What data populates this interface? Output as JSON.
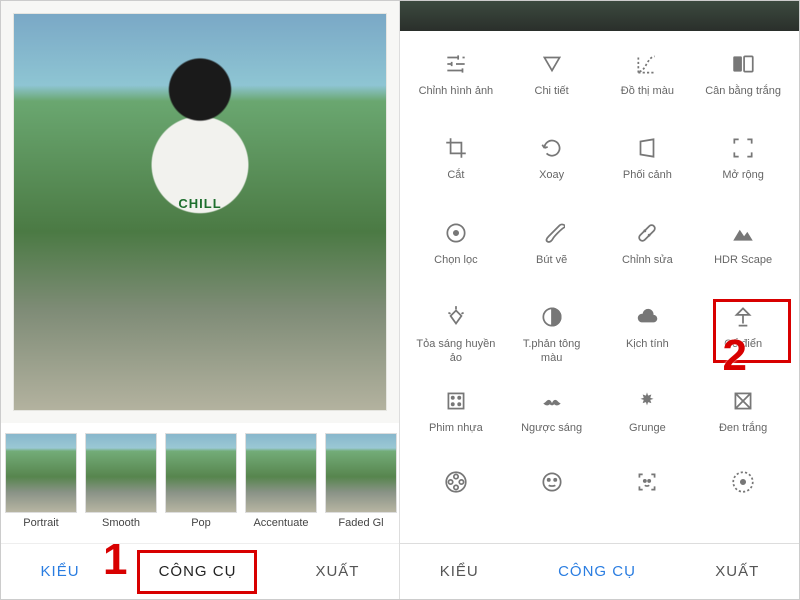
{
  "left": {
    "filters": [
      {
        "label": "Portrait"
      },
      {
        "label": "Smooth"
      },
      {
        "label": "Pop"
      },
      {
        "label": "Accentuate"
      },
      {
        "label": "Faded Gl"
      }
    ],
    "bottombar": {
      "kieu": "KIỂU",
      "congcu": "CÔNG CỤ",
      "xuat": "XUẤT"
    },
    "annot1": "1"
  },
  "right": {
    "tools": [
      [
        {
          "icon": "tune",
          "label": "Chỉnh hình ảnh"
        },
        {
          "icon": "triangle-down",
          "label": "Chi tiết"
        },
        {
          "icon": "curve",
          "label": "Đồ thị màu"
        },
        {
          "icon": "wb",
          "label": "Cân bằng trắng"
        }
      ],
      [
        {
          "icon": "crop",
          "label": "Cắt"
        },
        {
          "icon": "rotate",
          "label": "Xoay"
        },
        {
          "icon": "perspective",
          "label": "Phối cảnh"
        },
        {
          "icon": "expand",
          "label": "Mở rộng"
        }
      ],
      [
        {
          "icon": "target",
          "label": "Chọn lọc"
        },
        {
          "icon": "brush",
          "label": "Bút vẽ"
        },
        {
          "icon": "bandage",
          "label": "Chỉnh sửa"
        },
        {
          "icon": "mountain",
          "label": "HDR Scape"
        }
      ],
      [
        {
          "icon": "diamond-rays",
          "label": "Tỏa sáng huyền ảo"
        },
        {
          "icon": "contrast",
          "label": "T.phản tông màu"
        },
        {
          "icon": "cloud",
          "label": "Kịch tính"
        },
        {
          "icon": "lamp",
          "label": "Cổ điển"
        }
      ],
      [
        {
          "icon": "filmstrip",
          "label": "Phim nhựa"
        },
        {
          "icon": "mustache",
          "label": "Ngược sáng"
        },
        {
          "icon": "splat",
          "label": "Grunge"
        },
        {
          "icon": "bw",
          "label": "Đen trắng"
        }
      ],
      [
        {
          "icon": "reel",
          "label": ""
        },
        {
          "icon": "face",
          "label": ""
        },
        {
          "icon": "scanface",
          "label": ""
        },
        {
          "icon": "dots",
          "label": ""
        }
      ]
    ],
    "bottombar": {
      "kieu": "KIỂU",
      "congcu": "CÔNG CỤ",
      "xuat": "XUẤT"
    },
    "annot2": "2"
  }
}
